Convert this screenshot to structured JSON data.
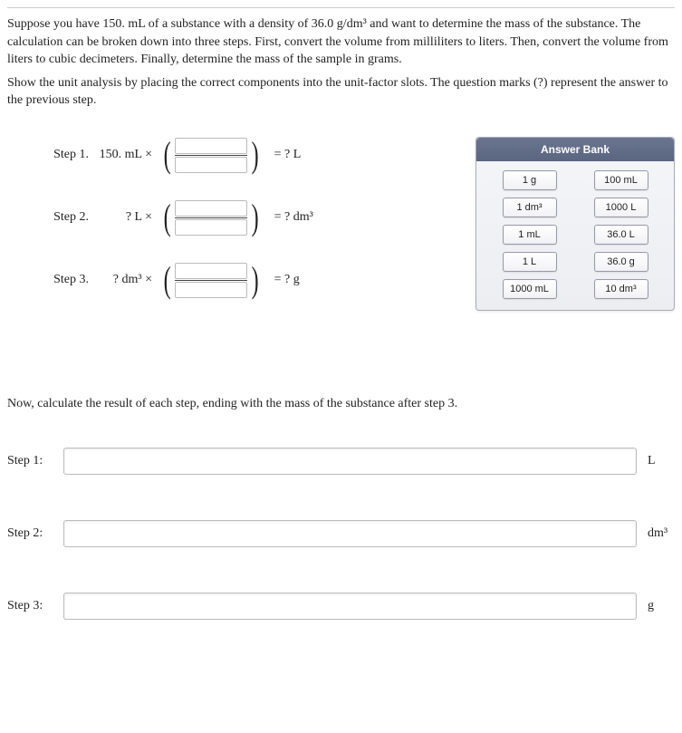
{
  "intro": {
    "p1": "Suppose you have 150. mL of a substance with a density of 36.0 g/dm³ and want to determine the mass of the substance. The calculation can be broken down into three steps. First, convert the volume from milliliters to liters. Then, convert the volume from liters to cubic decimeters. Finally, determine the mass of the sample in grams.",
    "p2": "Show the unit analysis by placing the correct components into the unit-factor slots. The question marks (?) represent the answer to the previous step."
  },
  "steps": {
    "s1": {
      "label": "Step 1.",
      "pre": "150. mL ×",
      "post": "= ? L"
    },
    "s2": {
      "label": "Step 2.",
      "pre": "? L ×",
      "post": "= ? dm³"
    },
    "s3": {
      "label": "Step 3.",
      "pre": "? dm³ ×",
      "post": "= ? g"
    }
  },
  "bank": {
    "title": "Answer Bank",
    "tiles": {
      "t0": "1 g",
      "t1": "100 mL",
      "t2": "1 dm³",
      "t3": "1000 L",
      "t4": "1 mL",
      "t5": "36.0 L",
      "t6": "1 L",
      "t7": "36.0 g",
      "t8": "1000 mL",
      "t9": "10 dm³"
    }
  },
  "calc": {
    "prompt": "Now, calculate the result of each step, ending with the mass of the substance after step 3.",
    "rows": {
      "r1": {
        "label": "Step 1:",
        "unit": "L"
      },
      "r2": {
        "label": "Step 2:",
        "unit": "dm³"
      },
      "r3": {
        "label": "Step 3:",
        "unit": "g"
      }
    }
  }
}
